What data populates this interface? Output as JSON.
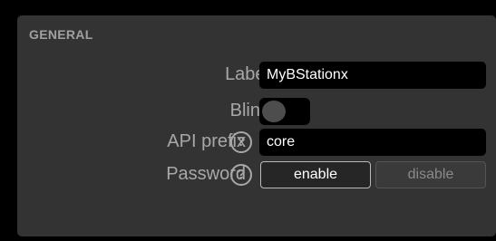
{
  "section": {
    "title": "GENERAL"
  },
  "fields": {
    "label": {
      "label": "Label",
      "value": "MyBStationx"
    },
    "blink": {
      "label": "Blink",
      "state": "off"
    },
    "api_prefix": {
      "label": "API prefix",
      "help_glyph": "?",
      "value": "core"
    },
    "password": {
      "label": "Password",
      "help_glyph": "?",
      "options": [
        "enable",
        "disable"
      ],
      "selected": "enable"
    }
  },
  "icons": {
    "help": "help-circle-icon"
  },
  "colors": {
    "panel_bg": "#333333",
    "input_bg": "#000000",
    "label_text": "#a8a8a8",
    "value_text": "#ffffff"
  }
}
